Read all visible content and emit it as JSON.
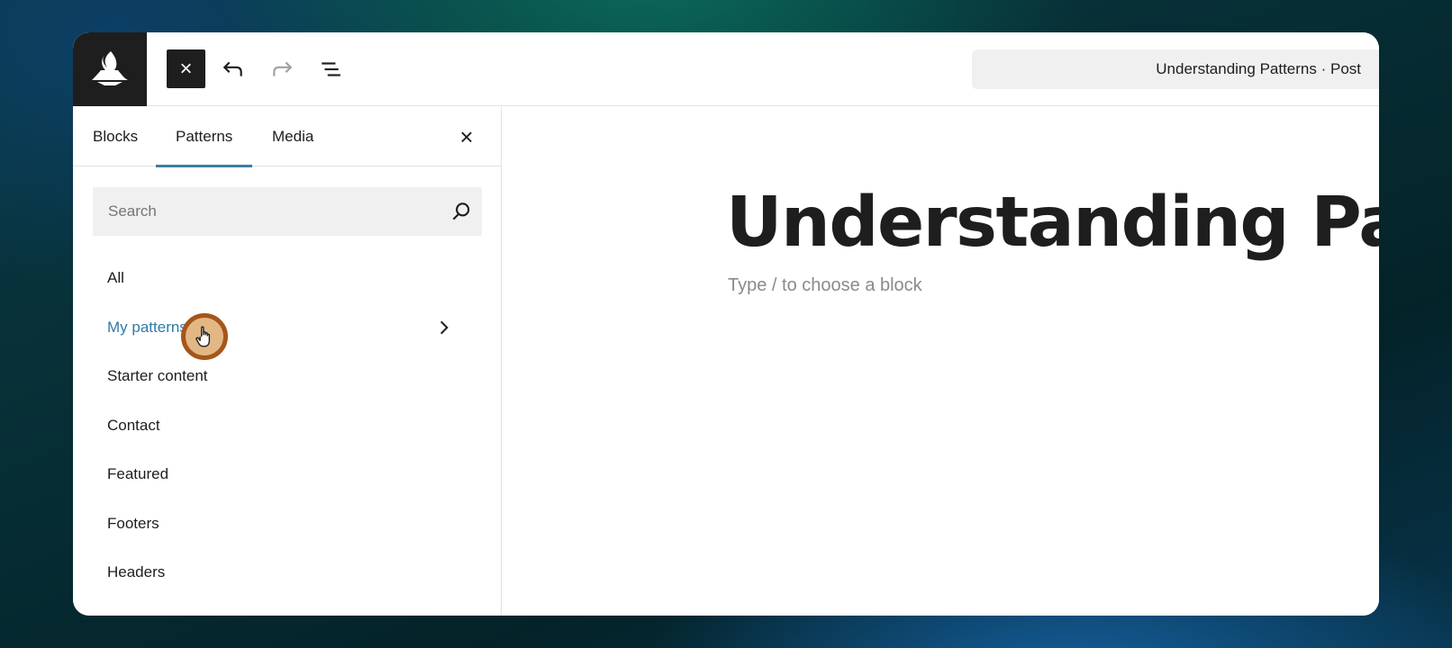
{
  "toolbar": {
    "close_label": "×",
    "document_title": "Understanding Patterns · Post"
  },
  "inserter": {
    "tabs": [
      {
        "label": "Blocks",
        "active": false
      },
      {
        "label": "Patterns",
        "active": true
      },
      {
        "label": "Media",
        "active": false
      }
    ],
    "close_label": "×",
    "search": {
      "placeholder": "Search",
      "value": ""
    },
    "categories": [
      {
        "label": "All"
      },
      {
        "label": "My patterns",
        "active": true
      },
      {
        "label": "Starter content"
      },
      {
        "label": "Contact"
      },
      {
        "label": "Featured"
      },
      {
        "label": "Footers"
      },
      {
        "label": "Headers"
      }
    ]
  },
  "editor": {
    "title": "Understanding Patterns",
    "placeholder": "Type / to choose a block"
  },
  "colors": {
    "accent": "#3a7ea3",
    "active_text": "#2f7aa6",
    "dark": "#1e1e1e",
    "cursor_ring": "#a5561a"
  },
  "icons": [
    "site-logo-icon",
    "close-icon",
    "undo-icon",
    "redo-icon",
    "list-view-icon",
    "search-icon",
    "chevron-right-icon",
    "hand-pointer-icon"
  ]
}
